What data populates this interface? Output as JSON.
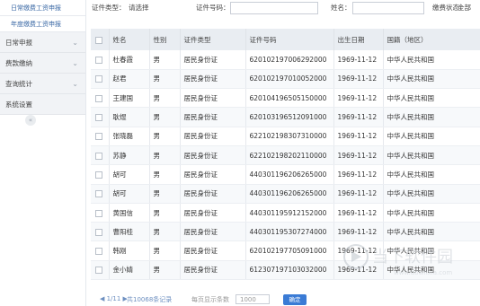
{
  "sidebar": {
    "sub_items": [
      "日常缴费工资申报",
      "年度缴费工资申报"
    ],
    "groups": [
      "日常申报",
      "费款缴纳",
      "查询统计",
      "系统设置"
    ],
    "collapse_glyph": "«"
  },
  "filters": {
    "cert_type_label": "证件类型：",
    "cert_type_value": "请选择",
    "cert_no_label": "证件号码：",
    "name_label": "姓名：",
    "status_label": "缴费状态：",
    "status_value": "全部"
  },
  "table": {
    "headers": [
      "姓名",
      "性别",
      "证件类型",
      "证件号码",
      "出生日期",
      "国籍（地区）"
    ],
    "rows": [
      [
        "杜春霞",
        "男",
        "居民身份证",
        "620102197006292000",
        "1969-11-12",
        "中华人民共和国"
      ],
      [
        "赵君",
        "男",
        "居民身份证",
        "620102197010052000",
        "1969-11-12",
        "中华人民共和国"
      ],
      [
        "王建国",
        "男",
        "居民身份证",
        "620104196505150000",
        "1969-11-12",
        "中华人民共和国"
      ],
      [
        "耿煜",
        "男",
        "居民身份证",
        "620103196512091000",
        "1969-11-12",
        "中华人民共和国"
      ],
      [
        "张晓磊",
        "男",
        "居民身份证",
        "622102198307310000",
        "1969-11-12",
        "中华人民共和国"
      ],
      [
        "苏静",
        "男",
        "居民身份证",
        "622102198202110000",
        "1969-11-12",
        "中华人民共和国"
      ],
      [
        "胡可",
        "男",
        "居民身份证",
        "440301196206265000",
        "1969-11-12",
        "中华人民共和国"
      ],
      [
        "胡可",
        "男",
        "居民身份证",
        "440301196206265000",
        "1969-11-12",
        "中华人民共和国"
      ],
      [
        "黄国信",
        "男",
        "居民身份证",
        "440301195912152000",
        "1969-11-12",
        "中华人民共和国"
      ],
      [
        "曹阳桂",
        "男",
        "居民身份证",
        "440301195307274000",
        "1969-11-12",
        "中华人民共和国"
      ],
      [
        "韩刚",
        "男",
        "居民身份证",
        "620102197705091000",
        "1969-11-12",
        "中华人民共和国"
      ],
      [
        "金小婧",
        "男",
        "居民身份证",
        "612307197103032000",
        "1969-11-12",
        "中华人民共和国"
      ]
    ]
  },
  "pager": {
    "nav": "◀ 1/11 ▶",
    "total": "共10068条记录",
    "page_size_label": "每页显示条数",
    "page_size_value": "1000",
    "ok_label": "确定"
  },
  "watermark": {
    "main": "当下软件园",
    "url": "www.downxia.com"
  },
  "colors": {
    "accent": "#3a7bd5",
    "header_bg": "#e9edf2",
    "sidebar_group_bg": "#f1f3f6"
  }
}
